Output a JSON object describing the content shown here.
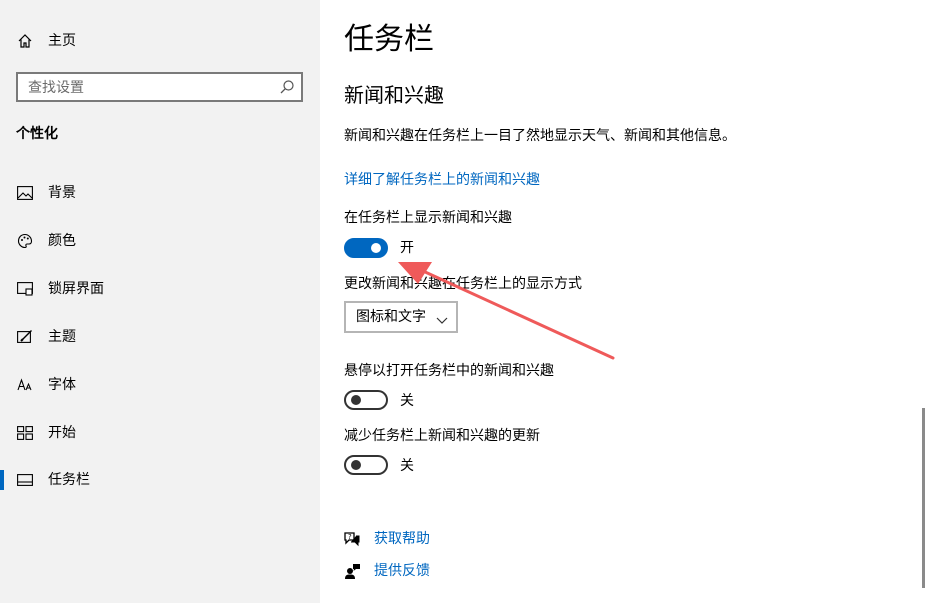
{
  "sidebar": {
    "home_label": "主页",
    "search_placeholder": "查找设置",
    "section_title": "个性化",
    "items": [
      {
        "label": "背景",
        "icon": "picture-icon"
      },
      {
        "label": "颜色",
        "icon": "palette-icon"
      },
      {
        "label": "锁屏界面",
        "icon": "lock-screen-icon"
      },
      {
        "label": "主题",
        "icon": "theme-brush-icon"
      },
      {
        "label": "字体",
        "icon": "font-icon"
      },
      {
        "label": "开始",
        "icon": "start-grid-icon"
      },
      {
        "label": "任务栏",
        "icon": "taskbar-icon",
        "selected": true
      }
    ]
  },
  "main": {
    "title": "任务栏",
    "subheading": "新闻和兴趣",
    "description": "新闻和兴趣在任务栏上一目了然地显示天气、新闻和其他信息。",
    "learn_more_link": "详细了解任务栏上的新闻和兴趣",
    "show_on_taskbar": {
      "label": "在任务栏上显示新闻和兴趣",
      "state": "开",
      "on": true
    },
    "display_mode": {
      "label": "更改新闻和兴趣在任务栏上的显示方式",
      "selected": "图标和文字"
    },
    "hover_open": {
      "label": "悬停以打开任务栏中的新闻和兴趣",
      "state": "关",
      "on": false
    },
    "reduce_updates": {
      "label": "减少任务栏上新闻和兴趣的更新",
      "state": "关",
      "on": false
    },
    "help_links": [
      {
        "label": "获取帮助",
        "icon": "help-chat-icon"
      },
      {
        "label": "提供反馈",
        "icon": "feedback-person-icon"
      }
    ]
  },
  "colors": {
    "accent": "#0067c0",
    "annotation_arrow": "#ef5a5a",
    "sidebar_bg": "#f2f2f2"
  }
}
